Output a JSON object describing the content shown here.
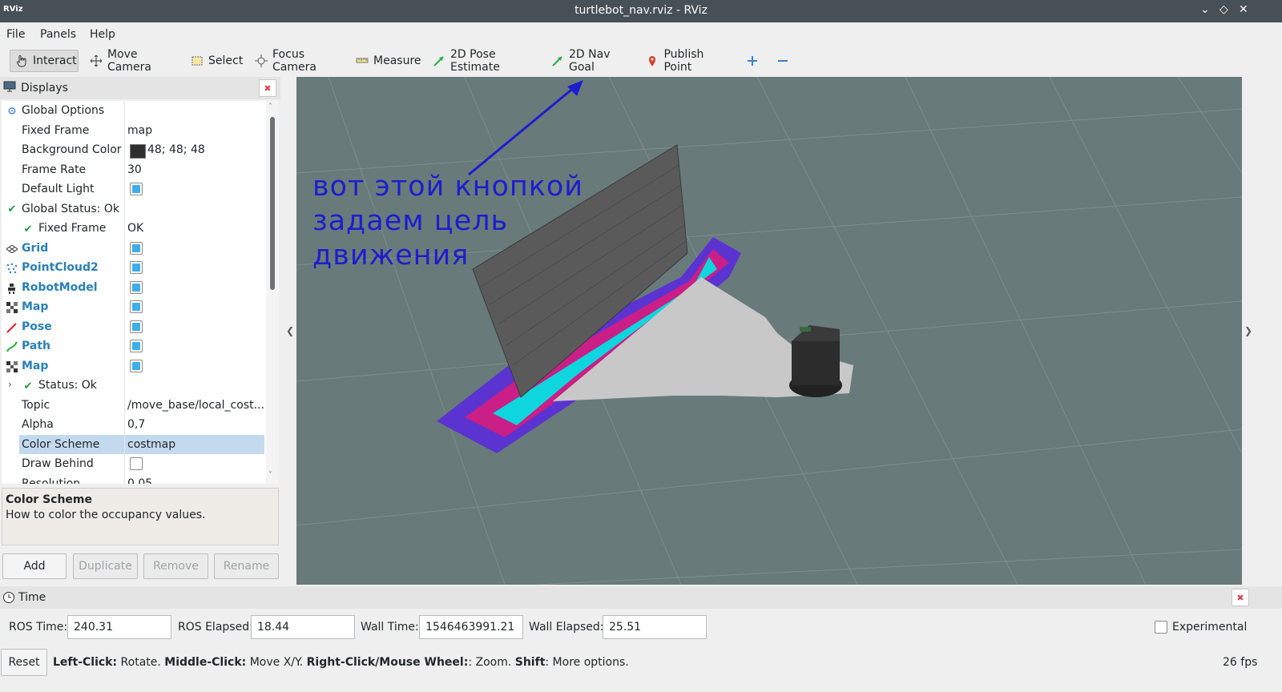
{
  "window": {
    "app_icon_text": "RViz",
    "title": "turtlebot_nav.rviz - RViz"
  },
  "menu": [
    "File",
    "Panels",
    "Help"
  ],
  "toolbar": {
    "interact": "Interact",
    "move_camera": "Move Camera",
    "select": "Select",
    "focus_camera": "Focus Camera",
    "measure": "Measure",
    "pose_estimate": "2D Pose Estimate",
    "nav_goal": "2D Nav Goal",
    "publish_point": "Publish Point"
  },
  "displays": {
    "title": "Displays",
    "rows": [
      {
        "label": "Global Options",
        "value": ""
      },
      {
        "label": "Fixed Frame",
        "value": "map"
      },
      {
        "label": "Background Color",
        "value": "48; 48; 48"
      },
      {
        "label": "Frame Rate",
        "value": "30"
      },
      {
        "label": "Default Light",
        "value": ""
      },
      {
        "label": "Global Status: Ok",
        "value": ""
      },
      {
        "label": "Fixed Frame",
        "value": "OK"
      },
      {
        "label": "Grid",
        "value": ""
      },
      {
        "label": "PointCloud2",
        "value": ""
      },
      {
        "label": "RobotModel",
        "value": ""
      },
      {
        "label": "Map",
        "value": ""
      },
      {
        "label": "Pose",
        "value": ""
      },
      {
        "label": "Path",
        "value": ""
      },
      {
        "label": "Map",
        "value": ""
      },
      {
        "label": "Status: Ok",
        "value": ""
      },
      {
        "label": "Topic",
        "value": "/move_base/local_cost..."
      },
      {
        "label": "Alpha",
        "value": "0,7"
      },
      {
        "label": "Color Scheme",
        "value": "costmap"
      },
      {
        "label": "Draw Behind",
        "value": ""
      },
      {
        "label": "Resolution",
        "value": "0.05"
      }
    ],
    "help_title": "Color Scheme",
    "help_text": "How to color the occupancy values.",
    "buttons": {
      "add": "Add",
      "duplicate": "Duplicate",
      "remove": "Remove",
      "rename": "Rename"
    }
  },
  "viewport": {
    "annotation": "вот этой кнопкой\nзадаем цель\nдвижения"
  },
  "time": {
    "title": "Time",
    "ros_time_label": "ROS Time:",
    "ros_time": "240.31",
    "ros_elapsed_label": "ROS Elapsed:",
    "ros_elapsed": "18.44",
    "wall_time_label": "Wall Time:",
    "wall_time": "1546463991.21",
    "wall_elapsed_label": "Wall Elapsed:",
    "wall_elapsed": "25.51",
    "experimental": "Experimental"
  },
  "status": {
    "reset": "Reset",
    "left_click": "Left-Click:",
    "left_click_desc": " Rotate. ",
    "middle_click": "Middle-Click:",
    "middle_click_desc": " Move X/Y. ",
    "right_click": "Right-Click/Mouse Wheel:",
    "right_click_desc": ": Zoom. ",
    "shift": "Shift",
    "shift_desc": ": More options.",
    "fps": "26 fps"
  }
}
